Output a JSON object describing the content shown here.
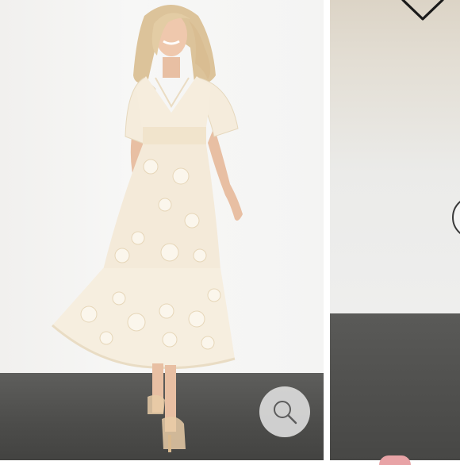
{
  "product_gallery": {
    "main_photo": {
      "icon": "dress-photo",
      "colors": {
        "wall": "#f4f4f3",
        "floor": "#4f4f4d",
        "dress": "#f4ead9"
      }
    },
    "next_photo_preview": {
      "icon": "room-photo",
      "colors": {
        "wall": "#ebebe9",
        "floor": "#4b4b49"
      }
    },
    "zoom_button": {
      "icon": "magnifier-icon"
    },
    "like_button": {
      "icon": "heart-outline-icon"
    },
    "next_arrow": {
      "icon": "chevron-right-icon"
    },
    "accent_color": "#e8a3a6"
  }
}
